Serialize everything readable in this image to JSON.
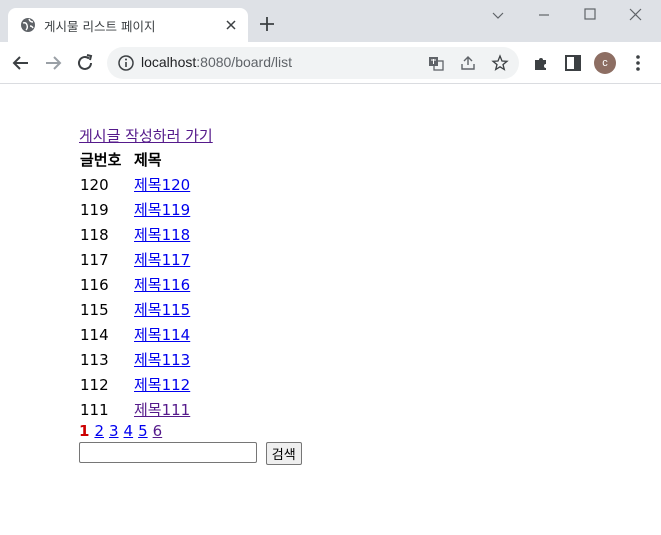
{
  "browser": {
    "tab_title": "게시물 리스트 페이지",
    "url_host": "localhost",
    "url_path": ":8080/board/list",
    "profile_initial": "c"
  },
  "page": {
    "write_link": "게시글 작성하러 가기",
    "headers": {
      "no": "글번호",
      "title": "제목"
    },
    "rows": [
      {
        "no": "120",
        "title": "제목120"
      },
      {
        "no": "119",
        "title": "제목119"
      },
      {
        "no": "118",
        "title": "제목118"
      },
      {
        "no": "117",
        "title": "제목117"
      },
      {
        "no": "116",
        "title": "제목116"
      },
      {
        "no": "115",
        "title": "제목115"
      },
      {
        "no": "114",
        "title": "제목114"
      },
      {
        "no": "113",
        "title": "제목113"
      },
      {
        "no": "112",
        "title": "제목112"
      },
      {
        "no": "111",
        "title": "제목111"
      }
    ],
    "pages": [
      "1",
      "2",
      "3",
      "4",
      "5",
      "6"
    ],
    "current_page": "1",
    "search": {
      "value": "",
      "button": "검색"
    }
  },
  "colors": {
    "link": "#0000ee",
    "visited_link": "#551a8b",
    "current_page": "#cc0000"
  }
}
